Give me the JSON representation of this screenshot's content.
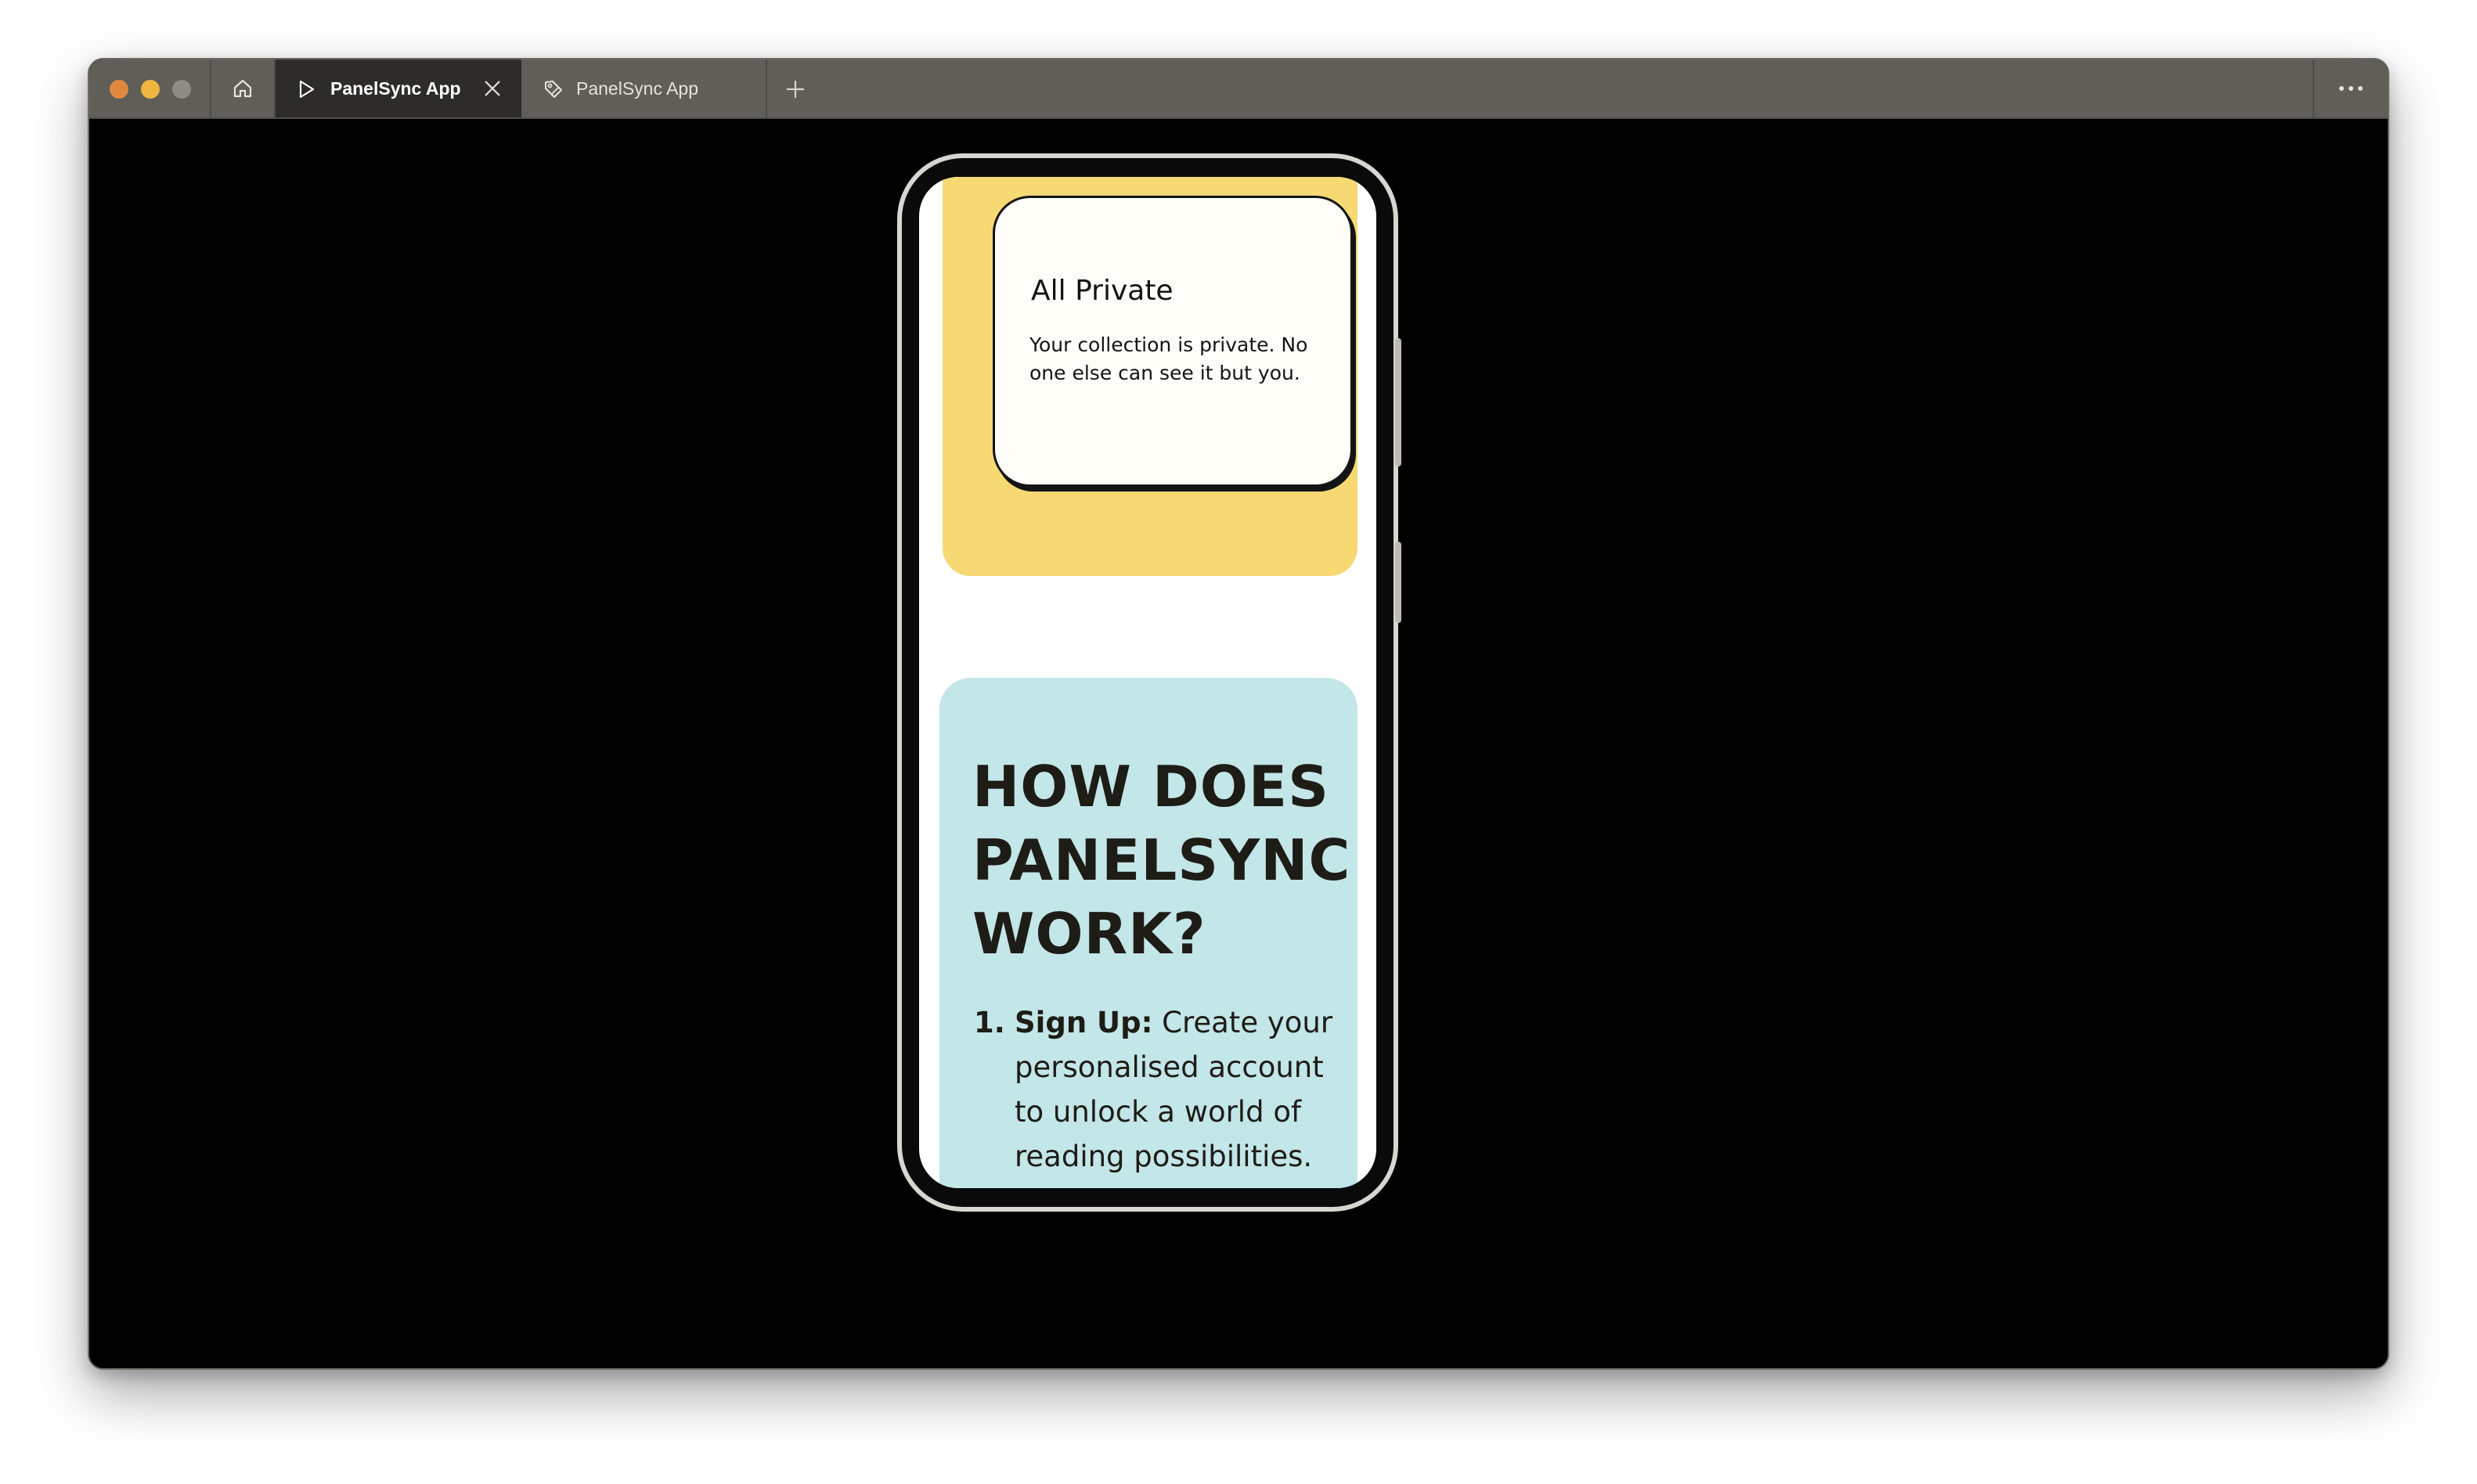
{
  "browser": {
    "tabs": [
      {
        "label": "PanelSync App",
        "active": true,
        "icon": "play-icon"
      },
      {
        "label": "PanelSync App",
        "active": false,
        "icon": "tag-icon"
      }
    ],
    "home_icon": "home-icon",
    "new_tab_icon": "plus-icon",
    "more_icon": "more-dots-icon"
  },
  "app": {
    "private_card": {
      "title": "All Private",
      "body": "Your collection is private. No one else can see it but you."
    },
    "how_section": {
      "title": "HOW DOES PANELSYNC WORK?",
      "steps": [
        {
          "number": "1.",
          "heading": "Sign Up:",
          "text": "Create your personalised account to unlock a world of reading possibilities."
        }
      ]
    }
  },
  "colors": {
    "yellow_panel": "#f6d973",
    "blue_panel": "#c3e6e8",
    "titlebar": "#5f5e58",
    "active_tab": "#2d2c28"
  }
}
